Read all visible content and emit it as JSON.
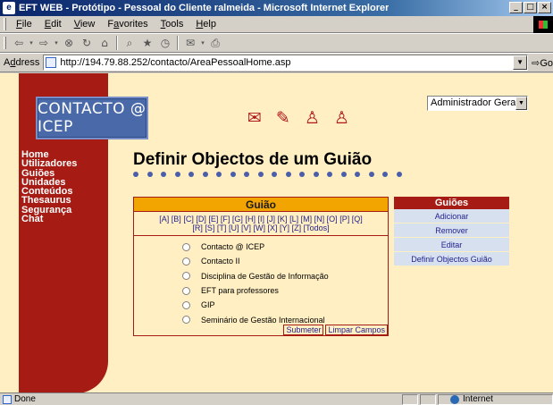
{
  "window": {
    "title": "EFT WEB - Protótipo - Pessoal do Cliente ralmeida - Microsoft Internet Explorer",
    "controls": [
      "minimize",
      "maximize",
      "close"
    ]
  },
  "menubar": {
    "items": [
      {
        "acc": "F",
        "rest": "ile"
      },
      {
        "acc": "E",
        "rest": "dit"
      },
      {
        "acc": "V",
        "rest": "iew"
      },
      {
        "pre": "F",
        "acc": "a",
        "rest": "vorites"
      },
      {
        "acc": "T",
        "rest": "ools"
      },
      {
        "acc": "H",
        "rest": "elp"
      }
    ]
  },
  "toolbar": {
    "buttons": [
      "back-icon",
      "forward-icon",
      "stop-icon",
      "refresh-icon",
      "home-icon",
      "search-icon",
      "favorites-icon",
      "history-icon",
      "mail-icon",
      "print-icon"
    ]
  },
  "address": {
    "label_acc": "d",
    "label_pre": "A",
    "label_rest": "dress",
    "url": "http://194.79.88.252/contacto/AreaPessoalHome.asp",
    "go_label": "Go"
  },
  "site": {
    "logo": "CONTACTO @ ICEP",
    "header_icons": [
      "envelope-icon",
      "book-icon",
      "person-icon",
      "people-icon"
    ],
    "user_select": "Administrador Geral",
    "nav": [
      "Home",
      "Utilizadores",
      "Guiões",
      "Unidades",
      "Conteúdos",
      "Thesaurus",
      "Segurança",
      "Chat"
    ],
    "colors": {
      "accent_red": "#a61b13",
      "page_bg": "#ffefc2",
      "header_orange": "#f2a400",
      "dot_blue": "#4b5eaa"
    }
  },
  "main": {
    "title": "Definir Objectos de um Guião",
    "dots_count": 20
  },
  "guiao": {
    "header": "Guião",
    "alphabet_row1": [
      "[A]",
      "[B]",
      "[C]",
      "[D]",
      "[E]",
      "[F]",
      "[G]",
      "[H]",
      "[I]",
      "[J]",
      "[K]",
      "[L]",
      "[M]",
      "[N]",
      "[O]",
      "[P]",
      "[Q]"
    ],
    "alphabet_row2": [
      "[R]",
      "[S]",
      "[T]",
      "[U]",
      "[V]",
      "[W]",
      "[X]",
      "[Y]",
      "[Z]",
      "[Todos]"
    ],
    "options": [
      "Contacto @ ICEP",
      "Contacto II",
      "Disciplina de Gestão de Informação",
      "EFT para professores",
      "GIP",
      "Seminário de Gestão Internacional"
    ],
    "submit_label": "Submeter",
    "clear_label": "Limpar Campos"
  },
  "guioes_panel": {
    "header": "Guiões",
    "items": [
      "Adicionar",
      "Remover",
      "Editar",
      "Definir Objectos Guião"
    ]
  },
  "status": {
    "text": "Done",
    "zone": "Internet"
  }
}
